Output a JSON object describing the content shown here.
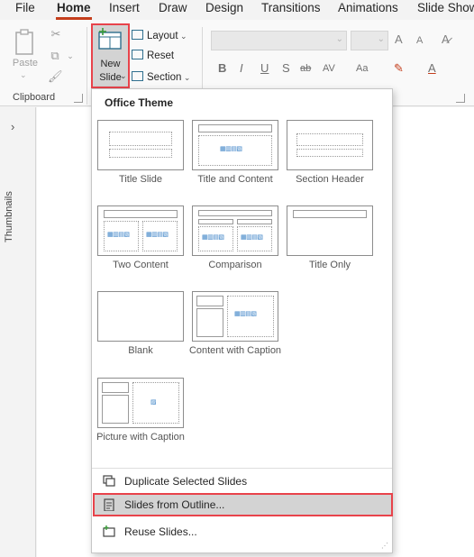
{
  "tabs": [
    "File",
    "Home",
    "Insert",
    "Draw",
    "Design",
    "Transitions",
    "Animations",
    "Slide Show"
  ],
  "active_tab": "Home",
  "ribbon": {
    "clipboard": {
      "paste_label": "Paste",
      "group_label": "Clipboard"
    },
    "slides": {
      "new_slide_line1": "New",
      "new_slide_line2": "Slide",
      "layout_label": "Layout",
      "reset_label": "Reset",
      "section_label": "Section"
    },
    "font": {
      "bold": "B",
      "italic": "I",
      "underline": "U",
      "shadow": "S",
      "strike": "ab",
      "spacing": "AV",
      "case": "Aa",
      "grow": "A",
      "shrink": "A"
    }
  },
  "thumbnails_pane": {
    "label": "Thumbnails",
    "chevron": "›"
  },
  "menu": {
    "section_title": "Office Theme",
    "layouts": [
      {
        "name": "Title Slide"
      },
      {
        "name": "Title and Content"
      },
      {
        "name": "Section Header"
      },
      {
        "name": "Two Content"
      },
      {
        "name": "Comparison"
      },
      {
        "name": "Title Only"
      },
      {
        "name": "Blank"
      },
      {
        "name": "Content with Caption"
      },
      {
        "name": "Picture with Caption"
      }
    ],
    "actions": [
      {
        "label": "Duplicate Selected Slides",
        "highlighted": false
      },
      {
        "label": "Slides from Outline...",
        "highlighted": true
      },
      {
        "label": "Reuse Slides...",
        "highlighted": false
      }
    ]
  },
  "colors": {
    "accent_red": "#e8434b",
    "tab_underline": "#c43e1c",
    "icon_teal": "#2e6f8e"
  }
}
